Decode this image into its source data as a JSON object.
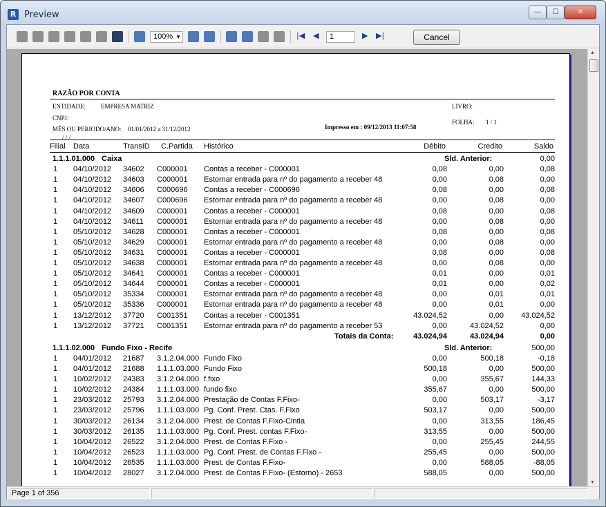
{
  "window": {
    "title": "Preview",
    "min": "—",
    "max": "☐",
    "close": "✕"
  },
  "toolbar": {
    "zoom": "100%",
    "page": "1",
    "cancel": "Cancel"
  },
  "status": {
    "page_info": "Page 1 of 356"
  },
  "report": {
    "title": "RAZÃO POR CONTA",
    "entidade_label": "ENTIDADE:",
    "entidade_value": "EMPRESA MATRIZ",
    "cnpj_label": "CNPJ:",
    "periodo_label": "MÊS OU PERIODO/ANO:",
    "periodo_value": "01/01/2012 a 31/12/2012",
    "blank_date": "/  /  /",
    "impresso": "Impresso em : 09/12/2013 11:07:58",
    "livro_label": "LIVRO:",
    "folha_label": "FOLHA:",
    "folha_value": "1 /  1",
    "columns": [
      "Filial",
      "Data",
      "TransID",
      "C.Partida",
      "Histórico",
      "Débito",
      "Credito",
      "Saldo"
    ],
    "accounts": [
      {
        "code": "1.1.1.01.000",
        "name": "Caixa",
        "sld_label": "Sld. Anterior:",
        "sld_value": "0,00",
        "rows": [
          [
            "1",
            "04/10/2012",
            "34602",
            "C000001",
            "Contas a receber - C000001",
            "0,08",
            "0,00",
            "0,08"
          ],
          [
            "1",
            "04/10/2012",
            "34603",
            "C000001",
            "Estornar entrada para nº do pagamento a receber 48",
            "0,00",
            "0,08",
            "0,00"
          ],
          [
            "1",
            "04/10/2012",
            "34606",
            "C000696",
            "Contas a receber - C000696",
            "0,08",
            "0,00",
            "0,08"
          ],
          [
            "1",
            "04/10/2012",
            "34607",
            "C000696",
            "Estornar entrada para nº do pagamento a receber 48",
            "0,00",
            "0,08",
            "0,00"
          ],
          [
            "1",
            "04/10/2012",
            "34609",
            "C000001",
            "Contas a receber - C000001",
            "0,08",
            "0,00",
            "0,08"
          ],
          [
            "1",
            "04/10/2012",
            "34611",
            "C000001",
            "Estornar entrada para nº do pagamento a receber 48",
            "0,00",
            "0,08",
            "0,00"
          ],
          [
            "1",
            "05/10/2012",
            "34628",
            "C000001",
            "Contas a receber - C000001",
            "0,08",
            "0,00",
            "0,08"
          ],
          [
            "1",
            "05/10/2012",
            "34629",
            "C000001",
            "Estornar entrada para nº do pagamento a receber 48",
            "0,00",
            "0,08",
            "0,00"
          ],
          [
            "1",
            "05/10/2012",
            "34631",
            "C000001",
            "Contas a receber - C000001",
            "0,08",
            "0,00",
            "0,08"
          ],
          [
            "1",
            "05/10/2012",
            "34638",
            "C000001",
            "Estornar entrada para nº do pagamento a receber 48",
            "0,00",
            "0,08",
            "0,00"
          ],
          [
            "1",
            "05/10/2012",
            "34641",
            "C000001",
            "Contas a receber - C000001",
            "0,01",
            "0,00",
            "0,01"
          ],
          [
            "1",
            "05/10/2012",
            "34644",
            "C000001",
            "Contas a receber - C000001",
            "0,01",
            "0,00",
            "0,02"
          ],
          [
            "1",
            "05/10/2012",
            "35334",
            "C000001",
            "Estornar entrada para nº do pagamento a receber 48",
            "0,00",
            "0,01",
            "0,01"
          ],
          [
            "1",
            "05/10/2012",
            "35336",
            "C000001",
            "Estornar entrada para nº do pagamento a receber 48",
            "0,00",
            "0,01",
            "0,00"
          ],
          [
            "1",
            "13/12/2012",
            "37720",
            "C001351",
            "Contas a receber - C001351",
            "43.024,52",
            "0,00",
            "43.024,52"
          ],
          [
            "1",
            "13/12/2012",
            "37721",
            "C001351",
            "Estornar entrada para nº do pagamento a receber 53",
            "0,00",
            "43.024,52",
            "0,00"
          ]
        ],
        "totals_label": "Totais da Conta:",
        "totals": [
          "43.024,94",
          "43.024,94",
          "0,00"
        ]
      },
      {
        "code": "1.1.1.02.000",
        "name": "Fundo Fixo - Recife",
        "sld_label": "Sld. Anterior:",
        "sld_value": "500,00",
        "rows": [
          [
            "1",
            "04/01/2012",
            "21687",
            "3.1.2.04.000",
            "Fundo Fixo",
            "0,00",
            "500,18",
            "-0,18"
          ],
          [
            "1",
            "04/01/2012",
            "21688",
            "1.1.1.03.000",
            "Fundo Fixo",
            "500,18",
            "0,00",
            "500,00"
          ],
          [
            "1",
            "10/02/2012",
            "24383",
            "3.1.2.04.000",
            "f.fixo",
            "0,00",
            "355,67",
            "144,33"
          ],
          [
            "1",
            "10/02/2012",
            "24384",
            "1.1.1.03.000",
            "fundo fixo",
            "355,67",
            "0,00",
            "500,00"
          ],
          [
            "1",
            "23/03/2012",
            "25793",
            "3.1.2.04.000",
            "Prestação de Contas F.Fixo-",
            "0,00",
            "503,17",
            "-3,17"
          ],
          [
            "1",
            "23/03/2012",
            "25796",
            "1.1.1.03.000",
            "Pg. Conf. Prest. Ctas. F.Fixo",
            "503,17",
            "0,00",
            "500,00"
          ],
          [
            "1",
            "30/03/2012",
            "26134",
            "3.1.2.04.000",
            "Prest. de Contas F.Fixo-Cintia",
            "0,00",
            "313,55",
            "186,45"
          ],
          [
            "1",
            "30/03/2012",
            "26135",
            "1.1.1.03.000",
            "Pg. Conf. Prest. contas F.Fixo-",
            "313,55",
            "0,00",
            "500,00"
          ],
          [
            "1",
            "10/04/2012",
            "26522",
            "3.1.2.04.000",
            "Prest. de Contas F.Fixo -",
            "0,00",
            "255,45",
            "244,55"
          ],
          [
            "1",
            "10/04/2012",
            "26523",
            "1.1.1.03.000",
            "Pg. Conf. Prest. de Contas F.Fixo -",
            "255,45",
            "0,00",
            "500,00"
          ],
          [
            "1",
            "10/04/2012",
            "26535",
            "1.1.1.03.000",
            "Prest. de Contas F.Fixo-",
            "0,00",
            "588,05",
            "-88,05"
          ],
          [
            "1",
            "10/04/2012",
            "28027",
            "3.1.2.04.000",
            "Prest. de Contas F.Fixo-              (Estorno) - 2653",
            "588,05",
            "0,00",
            "500,00"
          ]
        ]
      }
    ]
  }
}
